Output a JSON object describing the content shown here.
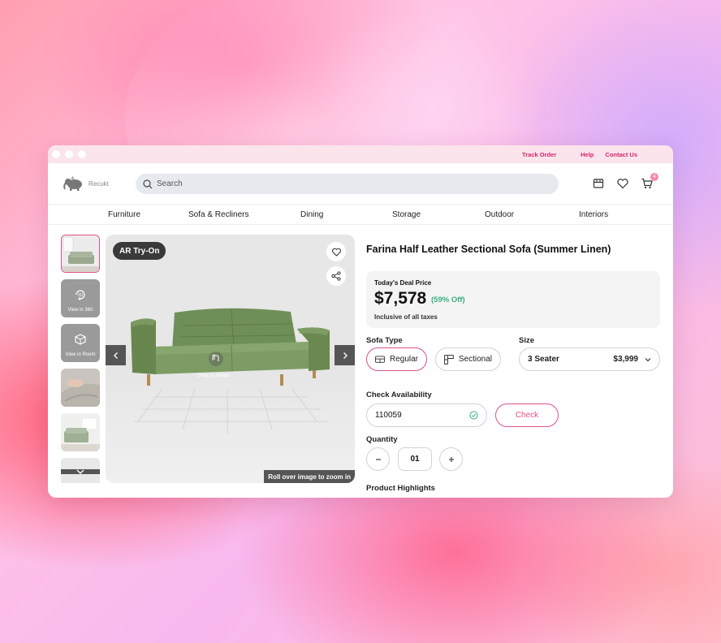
{
  "topbar": {
    "track_order": "Track Order",
    "help": "Help",
    "contact_us": "Contact Us"
  },
  "brand": {
    "name": "Recukt"
  },
  "search": {
    "placeholder": "Search"
  },
  "cart": {
    "count": "4"
  },
  "nav": {
    "items": [
      "Furniture",
      "Sofa & Recliners",
      "Dining",
      "Storage",
      "Outdoor",
      "Interiors"
    ]
  },
  "gallery": {
    "thumbs": [
      "",
      "View in 360",
      "View in Room",
      "",
      "",
      ""
    ],
    "ar_badge": "AR Try-On",
    "drag_hint": "Drag to rotate",
    "zoom_hint": "Roll over image to zoom in"
  },
  "product": {
    "title": "Farina Half Leather Sectional Sofa (Summer Linen)",
    "deal_label": "Today's Deal Price",
    "price": "$7,578",
    "discount": "(59% Off)",
    "tax_note": "Inclusive of all taxes",
    "sofa_type_label": "Sofa Type",
    "sofa_types": [
      "Regular",
      "Sectional"
    ],
    "selected_sofa_type": "Regular",
    "size_label": "Size",
    "size_value": "3 Seater",
    "size_price": "$3,999",
    "availability_label": "Check Availability",
    "pincode": "110059",
    "check_label": "Check",
    "quantity_label": "Quantity",
    "quantity": "01",
    "highlights_label": "Product Highlights"
  },
  "colors": {
    "accent": "#e0528b",
    "link": "#d6246b",
    "success": "#37b07e",
    "sofa": "#7a9a62"
  }
}
